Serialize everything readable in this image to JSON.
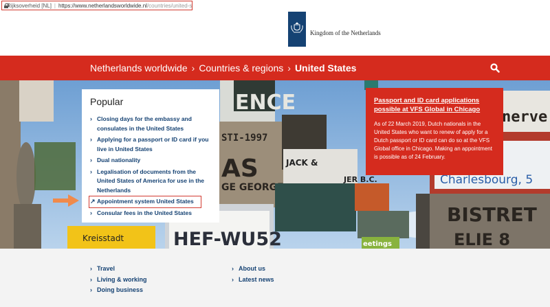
{
  "browser": {
    "site_name": "Rijksoverheid [NL]",
    "separator": "|",
    "url_host": "https://www.netherlandsworldwide.nl",
    "url_path": "/countries/united-states"
  },
  "header": {
    "logo_text": "Kingdom of the Netherlands"
  },
  "nav": {
    "crumbs": [
      "Netherlands worldwide",
      "Countries & regions",
      "United States"
    ],
    "chevron": "›"
  },
  "popular": {
    "title": "Popular",
    "items": [
      "Closing days for the embassy and consulates in the United States",
      "Applying for a passport or ID card if you live in United States",
      "Dual nationality",
      "Legalisation of documents from the United States of America for use in the Netherlands",
      "Appointment system United States",
      "Consular fees in the United States"
    ]
  },
  "news": {
    "title": "Passport and ID card applications possible at VFS Global in Chicago",
    "body": "As of 22 March 2019, Dutch nationals in the United States who want to renew of apply for a Dutch passport or ID card can do so at the VFS Global office in Chicago. Making an appointment is possible as of 24 February."
  },
  "signs": {
    "ence": "ENCE",
    "sti": "STI-1997",
    "as": "AS",
    "george": "GE GEORGE",
    "jack": "JACK &",
    "bc": "JER B.C.",
    "hef": "HEF-WU52",
    "kreisstadt": "Kreisstadt",
    "nerve": "nerve",
    "charlesbourg": "Charlesbourg, 5",
    "bistret": "BISTRET",
    "elie": "ELIE 8",
    "greetings": "eetings"
  },
  "footer": {
    "col1": [
      "Travel",
      "Living & working",
      "Doing business"
    ],
    "col2": [
      "About us",
      "Latest news"
    ]
  },
  "colors": {
    "brand_red": "#d52b1e",
    "link_blue": "#154273",
    "footer_bg": "#f3f3f3"
  }
}
